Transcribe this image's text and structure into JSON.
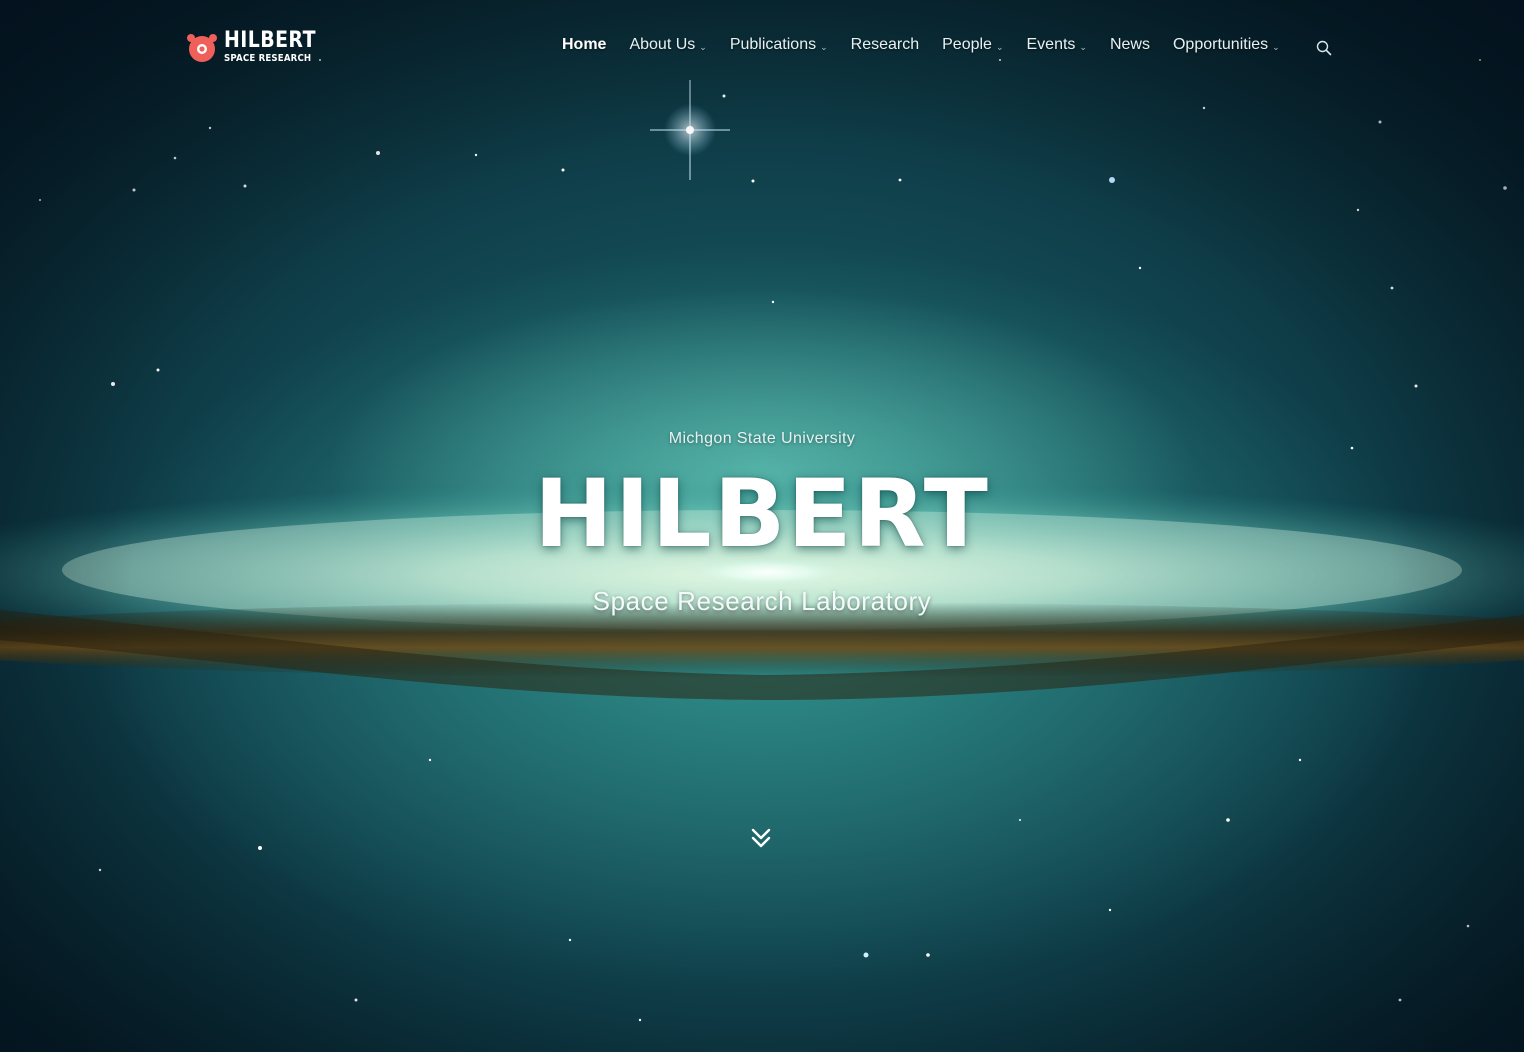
{
  "brand": {
    "title": "HILBERT",
    "subtitle": "SPACE RESEARCH",
    "logo_icon": "bear-face-icon",
    "accent_color": "#f0605a"
  },
  "nav": {
    "items": [
      {
        "label": "Home",
        "has_dropdown": false,
        "active": true
      },
      {
        "label": "About Us",
        "has_dropdown": true,
        "active": false
      },
      {
        "label": "Publications",
        "has_dropdown": true,
        "active": false
      },
      {
        "label": "Research",
        "has_dropdown": false,
        "active": false
      },
      {
        "label": "People",
        "has_dropdown": true,
        "active": false
      },
      {
        "label": "Events",
        "has_dropdown": true,
        "active": false
      },
      {
        "label": "News",
        "has_dropdown": false,
        "active": false
      },
      {
        "label": "Opportunities",
        "has_dropdown": true,
        "active": false
      }
    ],
    "dropdown_icon": "chevron-down-icon",
    "search_icon": "search-icon"
  },
  "hero": {
    "eyebrow": "Michgon State University",
    "title": "HILBERT",
    "subtitle": "Space Research Laboratory",
    "scroll_icon": "double-chevron-down-icon",
    "background": "edge-on spiral galaxy over starfield"
  }
}
